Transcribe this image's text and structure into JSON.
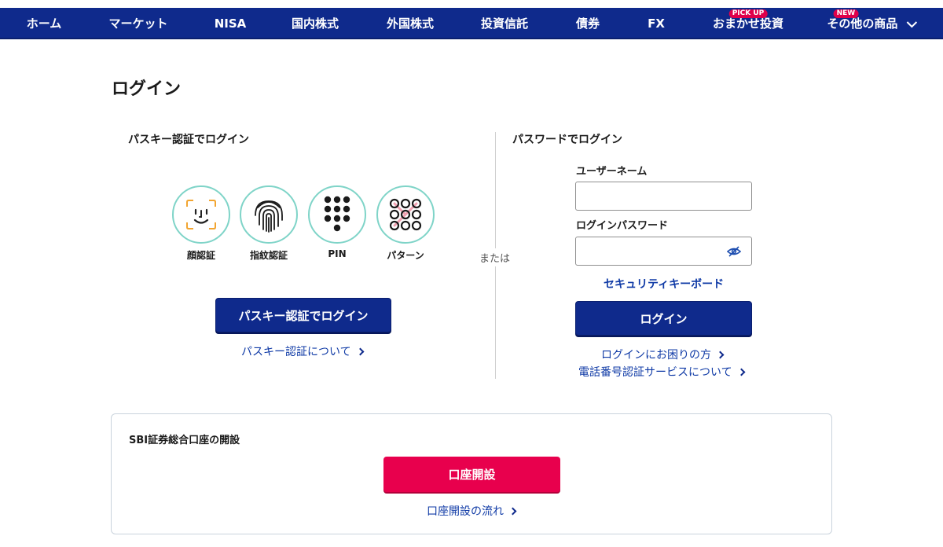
{
  "nav": {
    "items": [
      {
        "label": "ホーム"
      },
      {
        "label": "マーケット"
      },
      {
        "label": "NISA"
      },
      {
        "label": "国内株式"
      },
      {
        "label": "外国株式"
      },
      {
        "label": "投資信託"
      },
      {
        "label": "債券"
      },
      {
        "label": "FX"
      },
      {
        "label": "おまかせ投資",
        "badge": "PICK UP"
      },
      {
        "label": "その他の商品",
        "badge": "NEW"
      }
    ]
  },
  "page": {
    "title": "ログイン"
  },
  "passkey": {
    "heading": "パスキー認証でログイン",
    "methods": [
      {
        "label": "顔認証",
        "icon": "face-id-icon"
      },
      {
        "label": "指紋認証",
        "icon": "fingerprint-icon"
      },
      {
        "label": "PIN",
        "icon": "pin-keypad-icon"
      },
      {
        "label": "パターン",
        "icon": "pattern-lock-icon"
      }
    ],
    "button_label": "パスキー認証でログイン",
    "about_link": "パスキー認証について"
  },
  "divider": {
    "or_text": "または"
  },
  "password_login": {
    "heading": "パスワードでログイン",
    "username_label": "ユーザーネーム",
    "username_value": "",
    "password_label": "ログインパスワード",
    "password_value": "",
    "security_keyboard_link": "セキュリティキーボード",
    "button_label": "ログイン",
    "help_link": "ログインにお困りの方",
    "phone_auth_link": "電話番号認証サービスについて"
  },
  "account_open": {
    "heading": "SBI証券総合口座の開設",
    "button_label": "口座開設",
    "flow_link": "口座開設の流れ"
  },
  "colors": {
    "nav_bg": "#0f2a8c",
    "primary_button": "#0f2a8c",
    "open_button": "#e8004d",
    "badge": "#e0004a",
    "bio_ring": "#7fd4c8",
    "link": "#0f3aa6"
  }
}
